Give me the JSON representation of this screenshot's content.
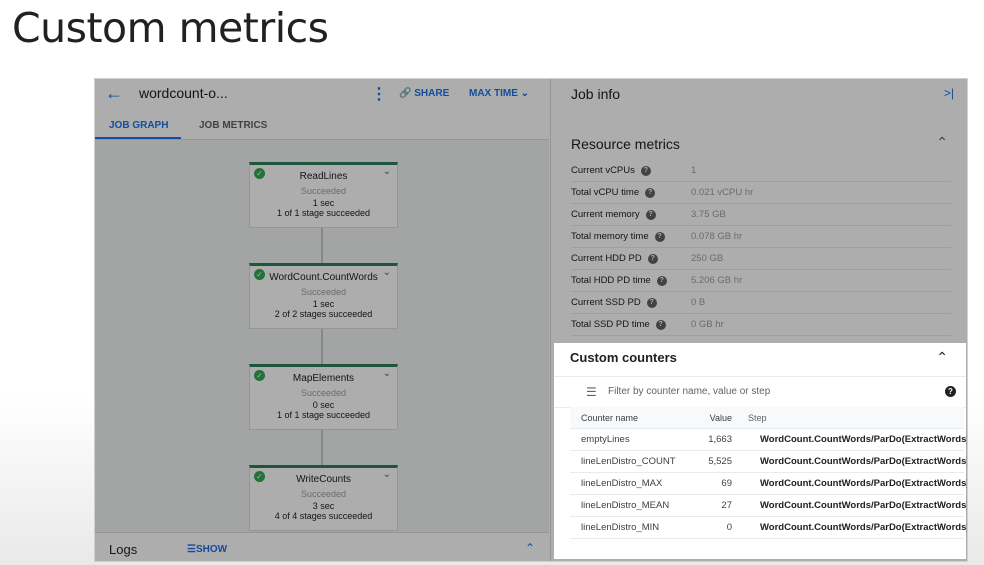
{
  "slide": {
    "title": "Custom metrics"
  },
  "header": {
    "job_name": "wordcount-o...",
    "share_label": "SHARE",
    "max_time_label": "MAX TIME"
  },
  "tabs": [
    {
      "label": "JOB GRAPH"
    },
    {
      "label": "JOB METRICS"
    }
  ],
  "graph": {
    "nodes": [
      {
        "name": "ReadLines",
        "status": "Succeeded",
        "time": "1 sec",
        "stages": "1 of 1 stage succeeded"
      },
      {
        "name": "WordCount.CountWords",
        "status": "Succeeded",
        "time": "1 sec",
        "stages": "2 of 2 stages succeeded"
      },
      {
        "name": "MapElements",
        "status": "Succeeded",
        "time": "0 sec",
        "stages": "1 of 1 stage succeeded"
      },
      {
        "name": "WriteCounts",
        "status": "Succeeded",
        "time": "3 sec",
        "stages": "4 of 4 stages succeeded"
      }
    ]
  },
  "logs": {
    "label": "Logs",
    "show_label": "SHOW"
  },
  "job_info": {
    "title": "Job info",
    "resource_metrics": {
      "title": "Resource metrics",
      "rows": [
        {
          "label": "Current vCPUs",
          "value": "1"
        },
        {
          "label": "Total vCPU time",
          "value": "0.021 vCPU hr"
        },
        {
          "label": "Current memory",
          "value": "3.75 GB"
        },
        {
          "label": "Total memory time",
          "value": "0.078 GB hr"
        },
        {
          "label": "Current HDD PD",
          "value": "250 GB"
        },
        {
          "label": "Total HDD PD time",
          "value": "5.206 GB hr"
        },
        {
          "label": "Current SSD PD",
          "value": "0 B"
        },
        {
          "label": "Total SSD PD time",
          "value": "0 GB hr"
        }
      ]
    },
    "custom_counters": {
      "title": "Custom counters",
      "filter_placeholder": "Filter by counter name, value or step",
      "columns": {
        "name": "Counter name",
        "value": "Value",
        "step": "Step"
      },
      "rows": [
        {
          "name": "emptyLines",
          "value": "1,663",
          "step": "WordCount.CountWords/ParDo(ExtractWords)"
        },
        {
          "name": "lineLenDistro_COUNT",
          "value": "5,525",
          "step": "WordCount.CountWords/ParDo(ExtractWords)"
        },
        {
          "name": "lineLenDistro_MAX",
          "value": "69",
          "step": "WordCount.CountWords/ParDo(ExtractWords)"
        },
        {
          "name": "lineLenDistro_MEAN",
          "value": "27",
          "step": "WordCount.CountWords/ParDo(ExtractWords)"
        },
        {
          "name": "lineLenDistro_MIN",
          "value": "0",
          "step": "WordCount.CountWords/ParDo(ExtractWords)"
        }
      ]
    }
  },
  "colors": {
    "accent": "#1a73e8",
    "success": "#34a853",
    "node_border": "#2e7d5b"
  }
}
